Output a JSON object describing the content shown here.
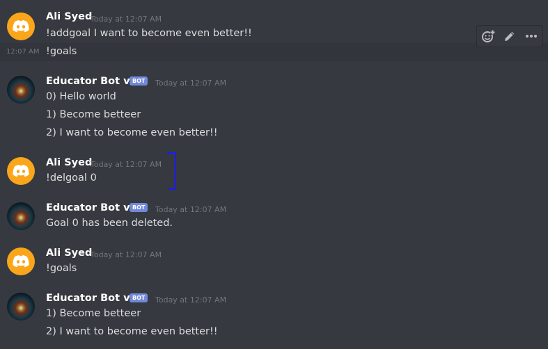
{
  "messages": [
    {
      "author": "Ali Syed",
      "timestamp": "Today at 12:07 AM",
      "lines": [
        "!addgoal I want to become even better!!"
      ]
    },
    {
      "side_time": "12:07 AM",
      "lines": [
        "!goals"
      ]
    },
    {
      "author": "Educator Bot vAli",
      "tag": "BOT",
      "timestamp": "Today at 12:07 AM",
      "lines": [
        "0) Hello world",
        "1) Become betteer",
        "2) I want to become even better!!"
      ]
    },
    {
      "author": "Ali Syed",
      "timestamp": "Today at 12:07 AM",
      "lines": [
        "!delgoal 0"
      ]
    },
    {
      "author": "Educator Bot vAli",
      "tag": "BOT",
      "timestamp": "Today at 12:07 AM",
      "lines": [
        "Goal 0 has been deleted."
      ]
    },
    {
      "author": "Ali Syed",
      "timestamp": "Today at 12:07 AM",
      "lines": [
        "!goals"
      ]
    },
    {
      "author": "Educator Bot vAli",
      "tag": "BOT",
      "timestamp": "Today at 12:07 AM",
      "lines": [
        "1) Become betteer",
        "2) I want to become even better!!"
      ]
    }
  ],
  "toolbar": {
    "icons": [
      "add-reaction-icon",
      "edit-icon",
      "more-options-icon"
    ]
  },
  "colors": {
    "background": "#36393f",
    "hover_row": "#32353b",
    "discord_avatar": "#faa61a",
    "bot_tag": "#7289da",
    "annotation_bracket": "#1a1aff"
  }
}
